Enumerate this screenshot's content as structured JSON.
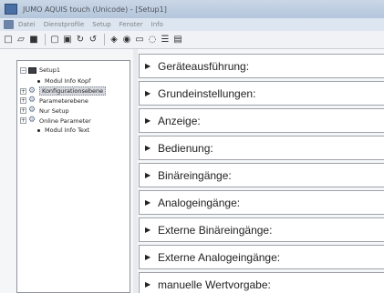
{
  "window": {
    "title": "JUMO AQUIS touch (Unicode) - [Setup1]"
  },
  "menubar": {
    "items": [
      "Datei",
      "Dienstprofile",
      "Setup",
      "Fenster",
      "Info"
    ]
  },
  "toolbar": {
    "buttons": [
      {
        "icon": "new-document-icon",
        "glyph": "□"
      },
      {
        "icon": "open-folder-icon",
        "glyph": "▱"
      },
      {
        "icon": "save-icon",
        "glyph": "■"
      },
      {
        "icon": "print-preview-icon",
        "glyph": "▢"
      },
      {
        "icon": "print-icon",
        "glyph": "▣"
      },
      {
        "icon": "transfer-to-device-icon",
        "glyph": "↻"
      },
      {
        "icon": "transfer-from-device-icon",
        "glyph": "↺"
      },
      {
        "icon": "connect-icon",
        "glyph": "◈"
      },
      {
        "icon": "online-icon",
        "glyph": "◉"
      },
      {
        "icon": "chart-icon",
        "glyph": "▭"
      },
      {
        "icon": "settings-icon",
        "glyph": "◌"
      },
      {
        "icon": "tile-windows-icon",
        "glyph": "☰"
      },
      {
        "icon": "window-icon",
        "glyph": "▤"
      }
    ]
  },
  "tree": {
    "root": "Setup1",
    "nodes": [
      {
        "label": "Modul Info Kopf",
        "type": "leaf"
      },
      {
        "label": "Konfigurationsebene",
        "type": "branch",
        "selected": true
      },
      {
        "label": "Parameterebene",
        "type": "branch"
      },
      {
        "label": "Nur Setup",
        "type": "branch"
      },
      {
        "label": "Online Parameter",
        "type": "branch"
      },
      {
        "label": "Modul Info Text",
        "type": "leaf"
      }
    ]
  },
  "groups": [
    "Geräteausführung:",
    "Grundeinstellungen:",
    "Anzeige:",
    "Bedienung:",
    "Binäreingänge:",
    "Analogeingänge:",
    "Externe Binäreingänge:",
    "Externe Analogeingänge:",
    "manuelle Wertvorgabe:"
  ]
}
